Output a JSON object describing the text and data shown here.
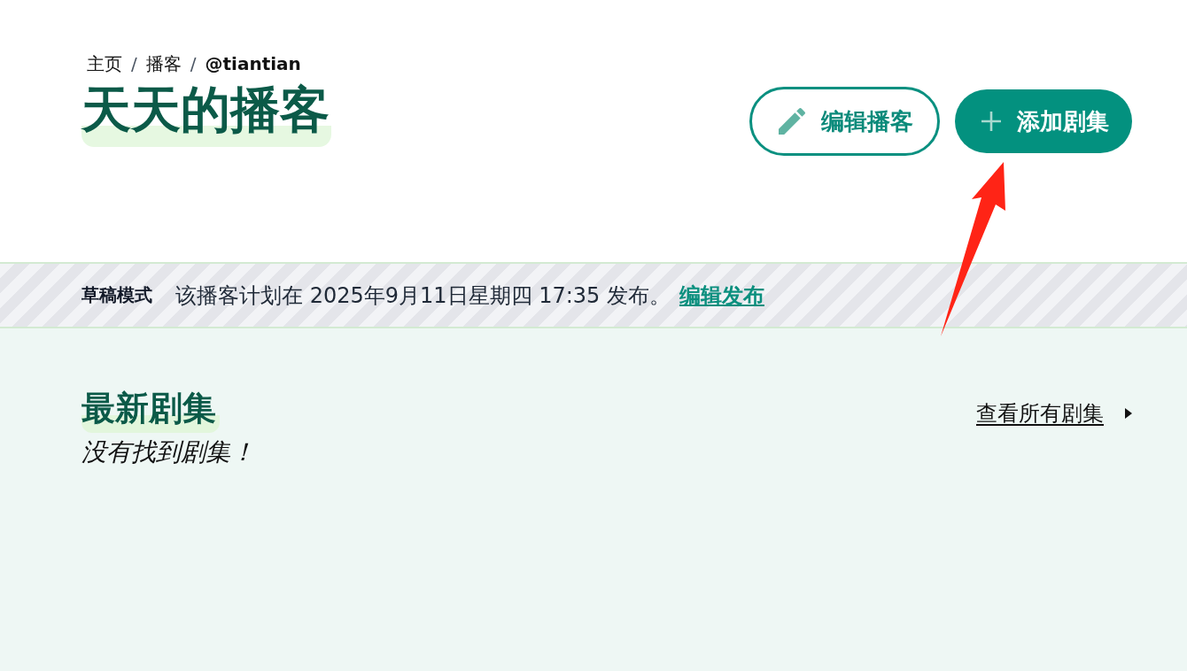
{
  "breadcrumb": {
    "separator": "/",
    "items": [
      {
        "label": "主页",
        "current": false
      },
      {
        "label": "播客",
        "current": false
      },
      {
        "label": "@tiantian",
        "current": true
      }
    ]
  },
  "title": "天天的播客",
  "actions": [
    {
      "kind": "outline",
      "label": "编辑播客"
    },
    {
      "kind": "filled",
      "label": "添加剧集"
    }
  ],
  "draft_banner": {
    "badge": "草稿模式",
    "message": "该播客计划在 2025年9月11日星期四 17:35 发布。",
    "link": "编辑发布"
  },
  "episodes": {
    "heading": "最新剧集",
    "empty_message": "没有找到剧集！",
    "view_all": "查看所有剧集"
  }
}
